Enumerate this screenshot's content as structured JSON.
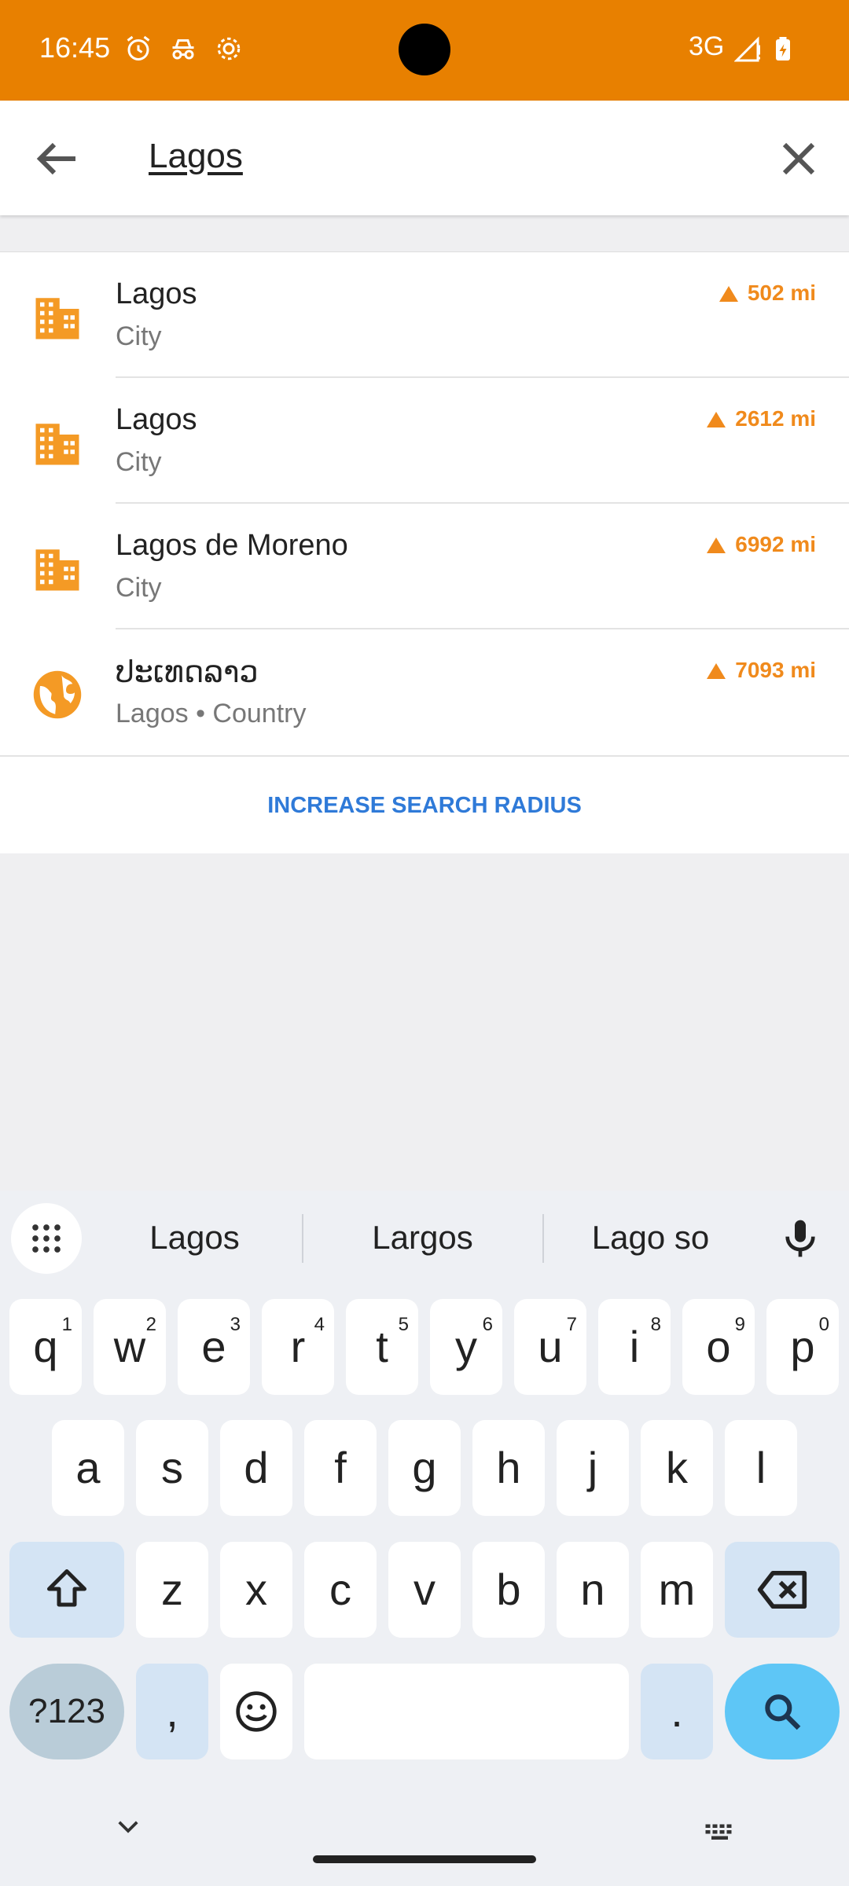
{
  "status_bar": {
    "time": "16:45",
    "network": "3G",
    "icons": [
      "alarm-icon",
      "incognito-icon",
      "settings-gear-icon",
      "signal-icon",
      "battery-charging-icon"
    ]
  },
  "search": {
    "query": "Lagos"
  },
  "results": [
    {
      "title": "Lagos",
      "subtitle": "City",
      "distance": "502 mi",
      "icon": "city-building-icon"
    },
    {
      "title": "Lagos",
      "subtitle": "City",
      "distance": "2612 mi",
      "icon": "city-building-icon"
    },
    {
      "title": "Lagos de Moreno",
      "subtitle": "City",
      "distance": "6992 mi",
      "icon": "city-building-icon"
    },
    {
      "title": "ປະເທດລາວ",
      "subtitle": "Lagos • Country",
      "distance": "7093 mi",
      "icon": "globe-icon"
    }
  ],
  "increase_radius_label": "INCREASE SEARCH RADIUS",
  "keyboard": {
    "suggestions": [
      "Lagos",
      "Largos",
      "Lago so"
    ],
    "row1": [
      {
        "k": "q",
        "h": "1"
      },
      {
        "k": "w",
        "h": "2"
      },
      {
        "k": "e",
        "h": "3"
      },
      {
        "k": "r",
        "h": "4"
      },
      {
        "k": "t",
        "h": "5"
      },
      {
        "k": "y",
        "h": "6"
      },
      {
        "k": "u",
        "h": "7"
      },
      {
        "k": "i",
        "h": "8"
      },
      {
        "k": "o",
        "h": "9"
      },
      {
        "k": "p",
        "h": "0"
      }
    ],
    "row2": [
      "a",
      "s",
      "d",
      "f",
      "g",
      "h",
      "j",
      "k",
      "l"
    ],
    "row3": [
      "z",
      "x",
      "c",
      "v",
      "b",
      "n",
      "m"
    ],
    "symbols_label": "?123",
    "comma": ",",
    "period": "."
  },
  "colors": {
    "accent": "#e88000",
    "distance": "#f08a1c",
    "link": "#2f7ad8"
  }
}
